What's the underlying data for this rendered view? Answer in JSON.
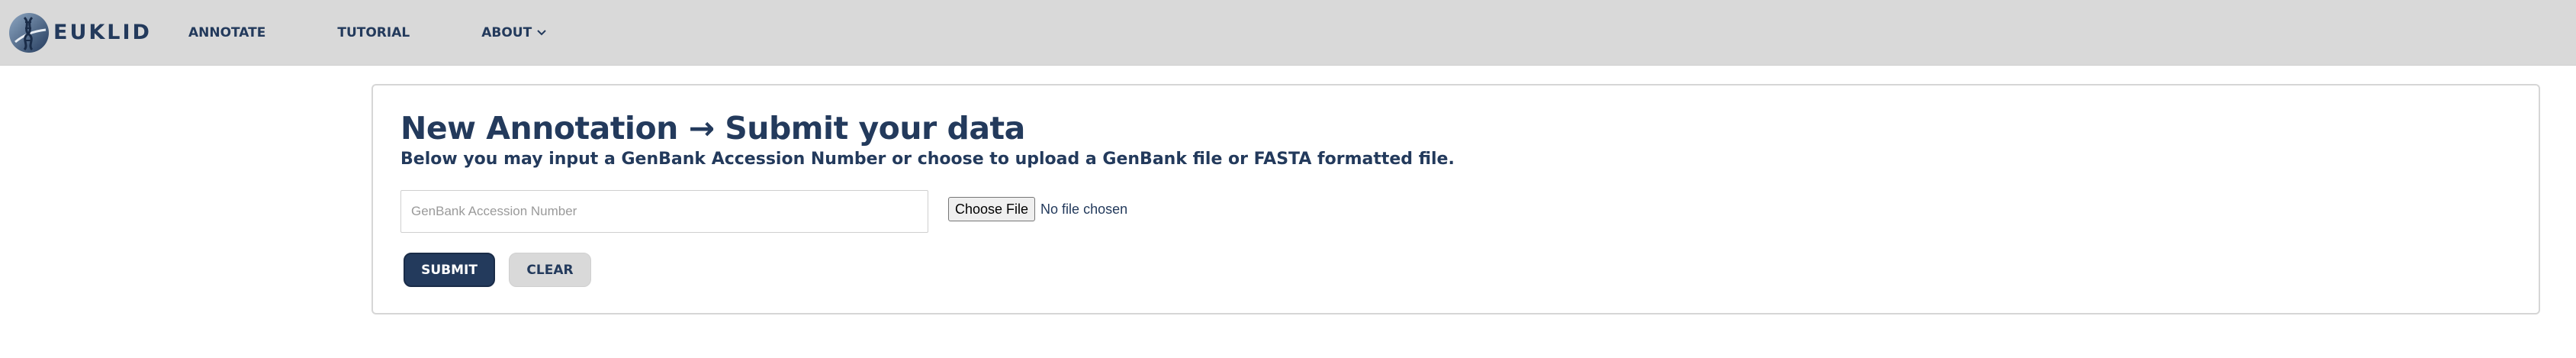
{
  "header": {
    "brand_name": "EUKLID",
    "logo_icon": "dna-globe-logo-icon",
    "nav": {
      "annotate": "ANNOTATE",
      "tutorial": "TUTORIAL",
      "about": "ABOUT"
    }
  },
  "form": {
    "title": "New Annotation → Submit your data",
    "subtitle": "Below you may input a GenBank Accession Number or choose to upload a GenBank file or FASTA formatted file.",
    "accession_value": "",
    "accession_placeholder": "GenBank Accession Number",
    "choose_file_label": "Choose File",
    "file_status": "No file chosen",
    "submit_label": "SUBMIT",
    "clear_label": "CLEAR"
  },
  "colors": {
    "navy": "#233a5c",
    "header_bg": "#d9d9d9",
    "clear_bg": "#d9d9d9"
  }
}
